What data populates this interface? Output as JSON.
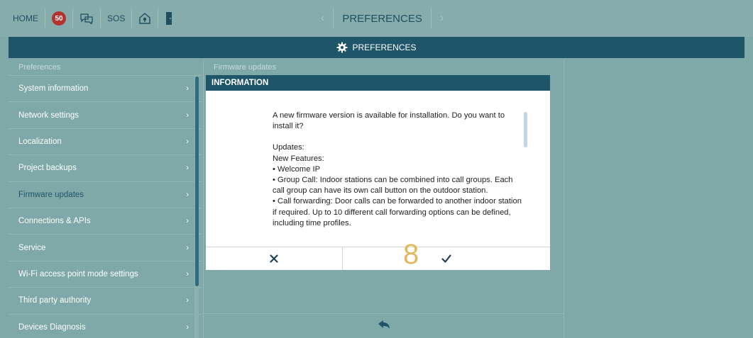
{
  "topbar": {
    "home_label": "HOME",
    "badge_count": "50",
    "sos_label": "SOS",
    "title": "PREFERENCES"
  },
  "header": {
    "label": "PREFERENCES"
  },
  "left_panel": {
    "title": "Preferences",
    "items": [
      {
        "label": "System information"
      },
      {
        "label": "Network settings"
      },
      {
        "label": "Localization"
      },
      {
        "label": "Project backups"
      },
      {
        "label": "Firmware updates"
      },
      {
        "label": "Connections & APIs"
      },
      {
        "label": "Service"
      },
      {
        "label": "Wi-Fi access point mode settings"
      },
      {
        "label": "Third party authority"
      },
      {
        "label": "Devices Diagnosis"
      }
    ]
  },
  "right_panel": {
    "title": "Firmware updates"
  },
  "dialog": {
    "title": "INFORMATION",
    "intro": "A new firmware version is available for installation. Do you want to install it?",
    "updates_label": "Updates:",
    "features_label": "New Features:",
    "bullet_1": "• Welcome IP",
    "bullet_2": "• Group Call: Indoor stations can be combined into call groups. Each call group can have its own call button on the outdoor station.",
    "bullet_3": "• Call forwarding: Door calls can be forwarded to another indoor station if required. Up to 10 different call forwarding options can be defined, including time profiles.",
    "step_number": "8"
  },
  "colors": {
    "background": "#7fa9a9",
    "header": "#1f5568",
    "badge": "#b5332e",
    "step_number": "#e2b85e"
  }
}
